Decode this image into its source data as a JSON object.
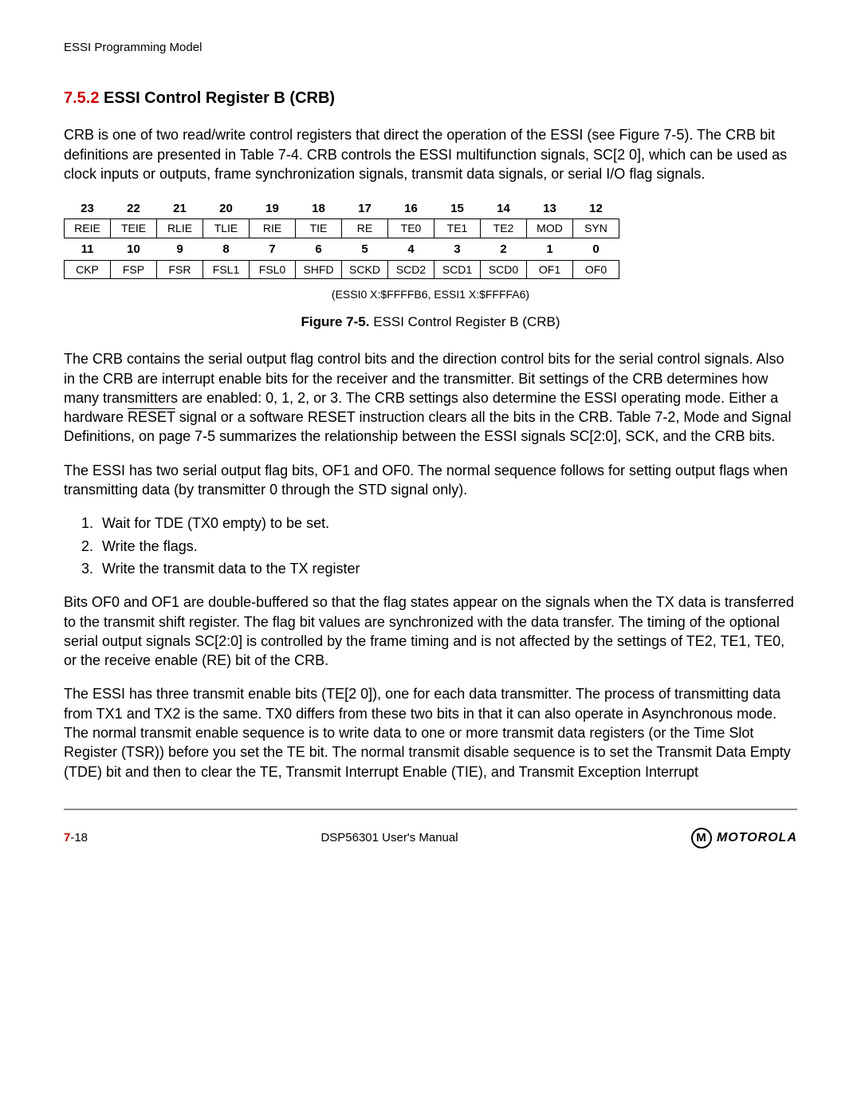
{
  "header": "ESSI Programming Model",
  "section": {
    "number": "7.5.2",
    "title": "ESSI Control Register B (CRB)"
  },
  "para1": "CRB is one of two read/write control registers that direct the operation of the ESSI (see Figure 7-5). The CRB bit definitions are presented in Table 7-4. CRB controls the ESSI multifunction signals, SC[2 0], which can be used as clock inputs or outputs, frame synchronization signals, transmit data signals, or serial I/O flag signals.",
  "bit_table": {
    "nums_high": [
      "23",
      "22",
      "21",
      "20",
      "19",
      "18",
      "17",
      "16",
      "15",
      "14",
      "13",
      "12"
    ],
    "names_high": [
      "REIE",
      "TEIE",
      "RLIE",
      "TLIE",
      "RIE",
      "TIE",
      "RE",
      "TE0",
      "TE1",
      "TE2",
      "MOD",
      "SYN"
    ],
    "nums_low": [
      "11",
      "10",
      "9",
      "8",
      "7",
      "6",
      "5",
      "4",
      "3",
      "2",
      "1",
      "0"
    ],
    "names_low": [
      "CKP",
      "FSP",
      "FSR",
      "FSL1",
      "FSL0",
      "SHFD",
      "SCKD",
      "SCD2",
      "SCD1",
      "SCD0",
      "OF1",
      "OF0"
    ]
  },
  "table_addr": "(ESSI0 X:$FFFFB6, ESSI1 X:$FFFFA6)",
  "figure_label": "Figure 7-5.",
  "figure_caption": "ESSI Control Register B (CRB)",
  "para2a": "The CRB contains the serial output flag control bits and the direction control bits for the serial control signals. Also in the CRB are interrupt enable bits for the receiver and the transmitter. Bit settings of the CRB determines how many transmitters are enabled: 0, 1, 2, or 3. The CRB settings also determine the ESSI operating mode. Either a hardware ",
  "para2_reset": "RESET",
  "para2b": " signal or a software RESET instruction clears all the bits in the CRB. Table 7-2, Mode and Signal Definitions, on page 7-5 summarizes the relationship between the ESSI signals SC[2:0], SCK, and the CRB bits.",
  "para3": "The ESSI has two serial output flag bits, OF1 and OF0. The normal sequence follows for setting output flags when transmitting data (by transmitter 0 through the STD signal only).",
  "steps": [
    "Wait for TDE (TX0 empty) to be set.",
    "Write the flags.",
    "Write the transmit data to the TX register"
  ],
  "para4": "Bits OF0 and OF1 are double-buffered so that the flag states appear on the signals when the TX data is transferred to the transmit shift register. The flag bit values are synchronized with the data transfer. The timing of the optional serial output signals SC[2:0] is controlled by the frame timing and is not affected by the settings of TE2, TE1, TE0, or the receive enable (RE) bit of the CRB.",
  "para5": "The ESSI has three transmit enable bits (TE[2 0]), one for each data transmitter. The process of transmitting data from TX1 and TX2 is the same. TX0 differs from these two bits in that it can also operate in Asynchronous mode. The normal transmit enable sequence is to write data to one or more transmit data registers (or the Time Slot Register (TSR)) before you set the TE bit. The normal transmit disable sequence is to set the Transmit Data Empty (TDE) bit and then to clear the TE, Transmit Interrupt Enable (TIE), and Transmit Exception Interrupt",
  "footer": {
    "page_chapter": "7",
    "page_num": "-18",
    "manual": "DSP56301 User's Manual",
    "logo": "MOTOROLA"
  }
}
